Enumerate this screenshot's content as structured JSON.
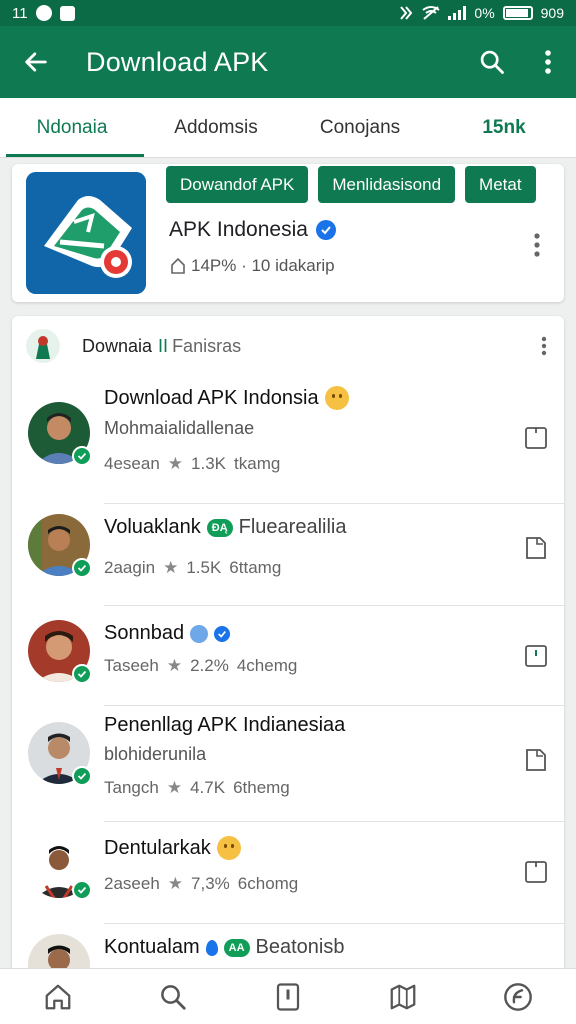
{
  "status_bar": {
    "time": "11",
    "right_text_1": "0%",
    "right_text_2": "909"
  },
  "app_bar": {
    "title": "Download APK",
    "back_icon": "arrow-back-icon",
    "search_icon": "search-icon",
    "more_icon": "more-vert-icon"
  },
  "tabs": [
    {
      "label": "Ndonaia",
      "active": true
    },
    {
      "label": "Addomsis",
      "active": false
    },
    {
      "label": "Conojans",
      "active": false
    },
    {
      "label": "15nk",
      "active": false
    }
  ],
  "app_card": {
    "chips": [
      "Dowandof APK",
      "Menlidasisond",
      "Metat"
    ],
    "name": "APK Indonesia",
    "meta": "14P% · 10 idakarip",
    "colors": {
      "logo_bg": "#1166aa",
      "accent": "#0f7a51"
    }
  },
  "list": {
    "header_title": "Downaia",
    "header_accent": "II",
    "header_sub": "Fanisras",
    "rows": [
      {
        "title": "Download APK Indonsia",
        "sub": "Mohmaialidallenae",
        "stat_a": "4esean",
        "stat_b": "1.3K",
        "stat_c": "tkamg"
      },
      {
        "title": "Voluaklank",
        "badge": "ĐĄ",
        "title_extra": "Fluearealilia",
        "stat_a": "2aagin",
        "stat_b": "1.5K",
        "stat_c": "6ttamg"
      },
      {
        "title": "Sonnbad",
        "stat_a": "Taseeh",
        "stat_b": "2.2%",
        "stat_c": "4chemg"
      },
      {
        "title": "Penenllag APK Indianesiaa",
        "sub": "blohiderunila",
        "stat_a": "Tangch",
        "stat_b": "4.7K",
        "stat_c": "6themg"
      },
      {
        "title": "Dentularkak",
        "stat_a": "2aseeh",
        "stat_b": "7,3%",
        "stat_c": "6chomg"
      },
      {
        "title": "Kontualam",
        "badge": "AA",
        "title_extra": "Beatonisb"
      }
    ]
  },
  "bottom_nav": [
    "home-icon",
    "search-icon",
    "library-icon",
    "map-icon",
    "discover-icon"
  ]
}
